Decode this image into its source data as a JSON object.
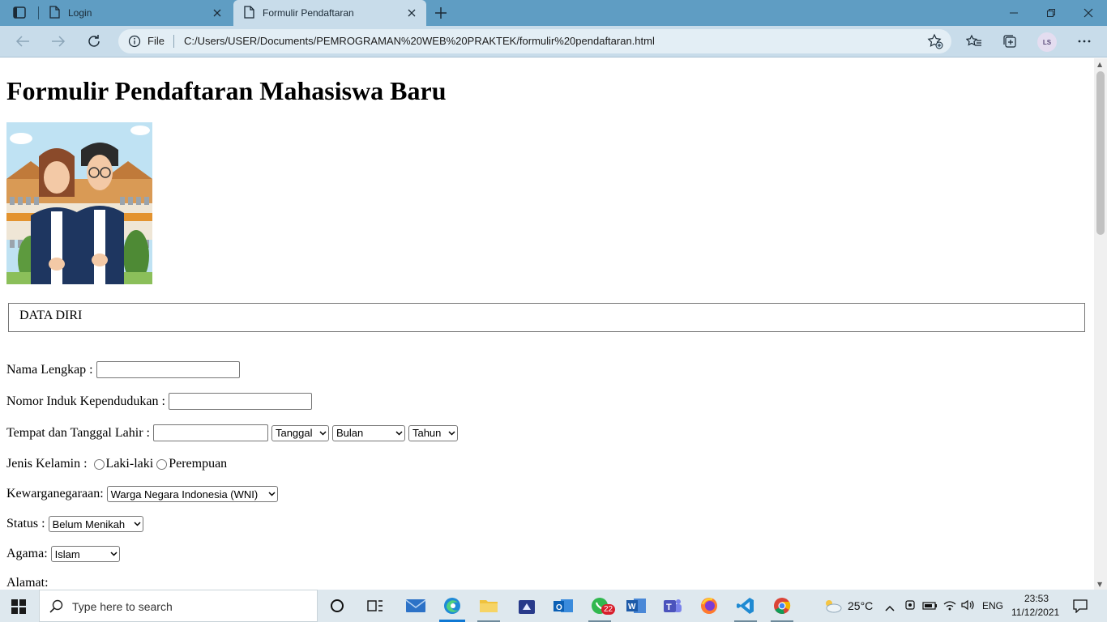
{
  "browser": {
    "tabs": [
      {
        "label": "Login"
      },
      {
        "label": "Formulir Pendaftaran"
      }
    ],
    "address": {
      "scheme_label": "File",
      "url": "C:/Users/USER/Documents/PEMROGRAMAN%20WEB%20PRAKTEK/formulir%20pendaftaran.html"
    },
    "profile_initials": "LS"
  },
  "page": {
    "title": "Formulir Pendaftaran Mahasiswa Baru",
    "section_legend": "DATA DIRI",
    "form": {
      "nama_label": "Nama Lengkap :",
      "nik_label": "Nomor Induk Kependudukan :",
      "ttl_label": "Tempat dan Tanggal Lahir :",
      "tanggal_select": "Tanggal",
      "bulan_select": "Bulan",
      "tahun_select": "Tahun",
      "gender_label": "Jenis Kelamin :",
      "gender_options": [
        "Laki-laki",
        "Perempuan"
      ],
      "kewarganegaraan_label": "Kewarganegaraan:",
      "kewarganegaraan_value": "Warga Negara Indonesia (WNI)",
      "status_label": "Status :",
      "status_value": "Belum Menikah",
      "agama_label": "Agama:",
      "agama_value": "Islam",
      "alamat_label": "Alamat:"
    }
  },
  "taskbar": {
    "search_placeholder": "Type here to search",
    "whatsapp_badge": "22",
    "weather": "25°C",
    "language": "ENG",
    "time": "23:53",
    "date": "11/12/2021"
  }
}
